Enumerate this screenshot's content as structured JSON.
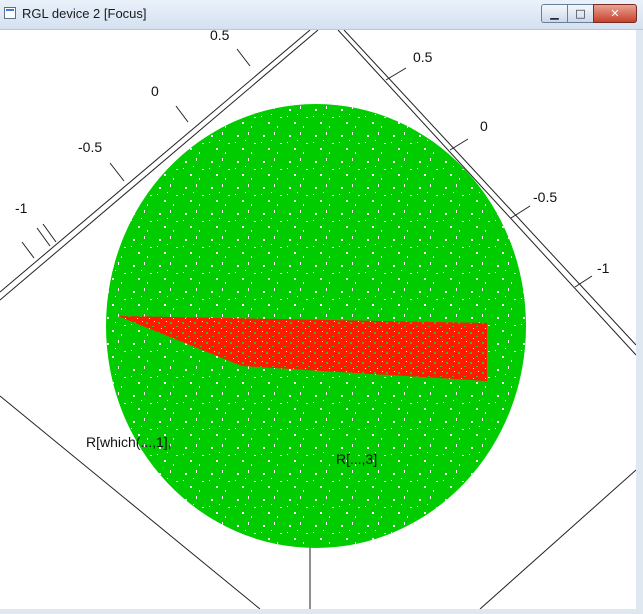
{
  "window": {
    "title": "RGL device 2 [Focus]",
    "icon": "app-window-icon",
    "controls": {
      "minimize": "▁",
      "maximize": "□",
      "close": "✕"
    }
  },
  "plot": {
    "axis_left_ticks": [
      "0.5",
      "0",
      "-0.5",
      "-1"
    ],
    "axis_right_ticks": [
      "0.5",
      "0",
      "-0.5",
      "-1"
    ],
    "xlabel": "R[which(...,1],",
    "zlabel": "R[...,3]",
    "colors": {
      "sphere": "#00cc00",
      "band": "#ff1a00",
      "background": "#ffffff"
    }
  }
}
